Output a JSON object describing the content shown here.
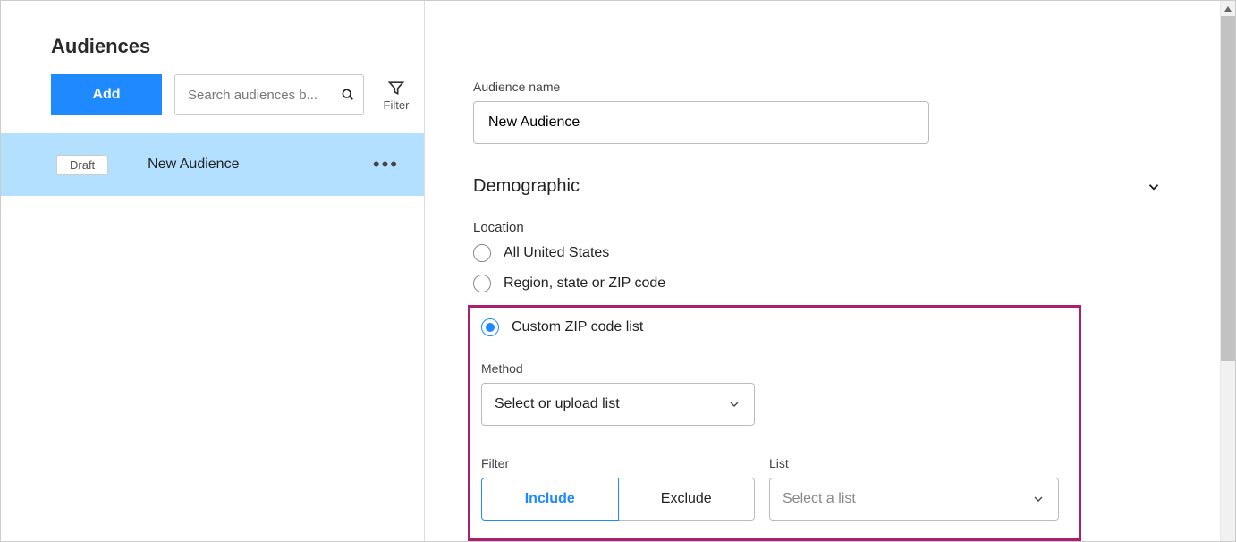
{
  "page": {
    "title": "Audiences"
  },
  "toolbar": {
    "add_label": "Add",
    "search_placeholder": "Search audiences b...",
    "filter_label": "Filter"
  },
  "list": {
    "items": [
      {
        "badge": "Draft",
        "name": "New Audience"
      }
    ]
  },
  "detail": {
    "name_label": "Audience name",
    "name_value": "New Audience",
    "demographic_heading": "Demographic",
    "location_label": "Location",
    "location_options": [
      "All United States",
      "Region, state or ZIP code",
      "Custom ZIP code list"
    ],
    "method_label": "Method",
    "method_value": "Select or upload list",
    "filter_label": "Filter",
    "filter_options": {
      "include": "Include",
      "exclude": "Exclude"
    },
    "list_label": "List",
    "list_placeholder": "Select a list"
  }
}
